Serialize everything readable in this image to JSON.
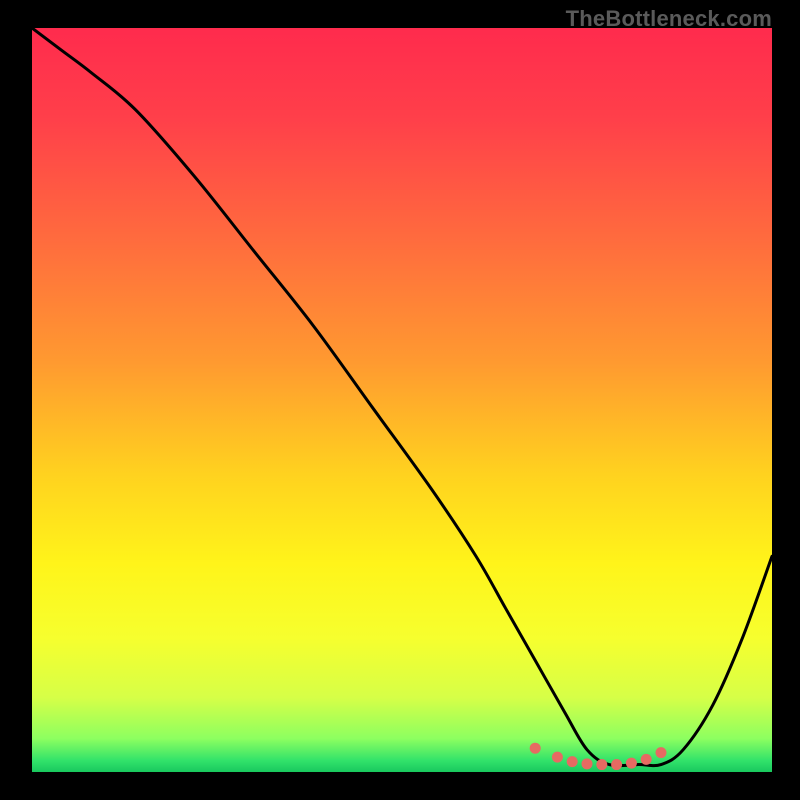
{
  "watermark": "TheBottleneck.com",
  "colors": {
    "frame": "#000000",
    "curve": "#000000",
    "dots": "#e66a62",
    "gradient_stops": [
      {
        "offset": 0.0,
        "color": "#ff2b4d"
      },
      {
        "offset": 0.12,
        "color": "#ff3f4a"
      },
      {
        "offset": 0.28,
        "color": "#ff6a3e"
      },
      {
        "offset": 0.45,
        "color": "#ff9a30"
      },
      {
        "offset": 0.6,
        "color": "#ffd21f"
      },
      {
        "offset": 0.72,
        "color": "#fff41a"
      },
      {
        "offset": 0.82,
        "color": "#f6ff2e"
      },
      {
        "offset": 0.9,
        "color": "#d6ff47"
      },
      {
        "offset": 0.955,
        "color": "#8dff60"
      },
      {
        "offset": 0.985,
        "color": "#31e26a"
      },
      {
        "offset": 1.0,
        "color": "#19c85e"
      }
    ]
  },
  "chart_data": {
    "type": "line",
    "title": "",
    "xlabel": "",
    "ylabel": "",
    "xlim": [
      0,
      100
    ],
    "ylim": [
      0,
      100
    ],
    "series": [
      {
        "name": "bottleneck-curve",
        "x": [
          0,
          4,
          8,
          14,
          22,
          30,
          38,
          46,
          54,
          60,
          64,
          68,
          72,
          75,
          78,
          82,
          85,
          88,
          92,
          96,
          100
        ],
        "y": [
          100,
          97,
          94,
          89,
          80,
          70,
          60,
          49,
          38,
          29,
          22,
          15,
          8,
          3,
          1,
          1,
          1,
          3,
          9,
          18,
          29
        ]
      }
    ],
    "highlight_dots": {
      "series": "bottleneck-curve",
      "x": [
        68,
        71,
        73,
        75,
        77,
        79,
        81,
        83,
        85
      ],
      "y": [
        3.2,
        2.0,
        1.4,
        1.1,
        1.0,
        1.0,
        1.2,
        1.7,
        2.6
      ]
    }
  }
}
